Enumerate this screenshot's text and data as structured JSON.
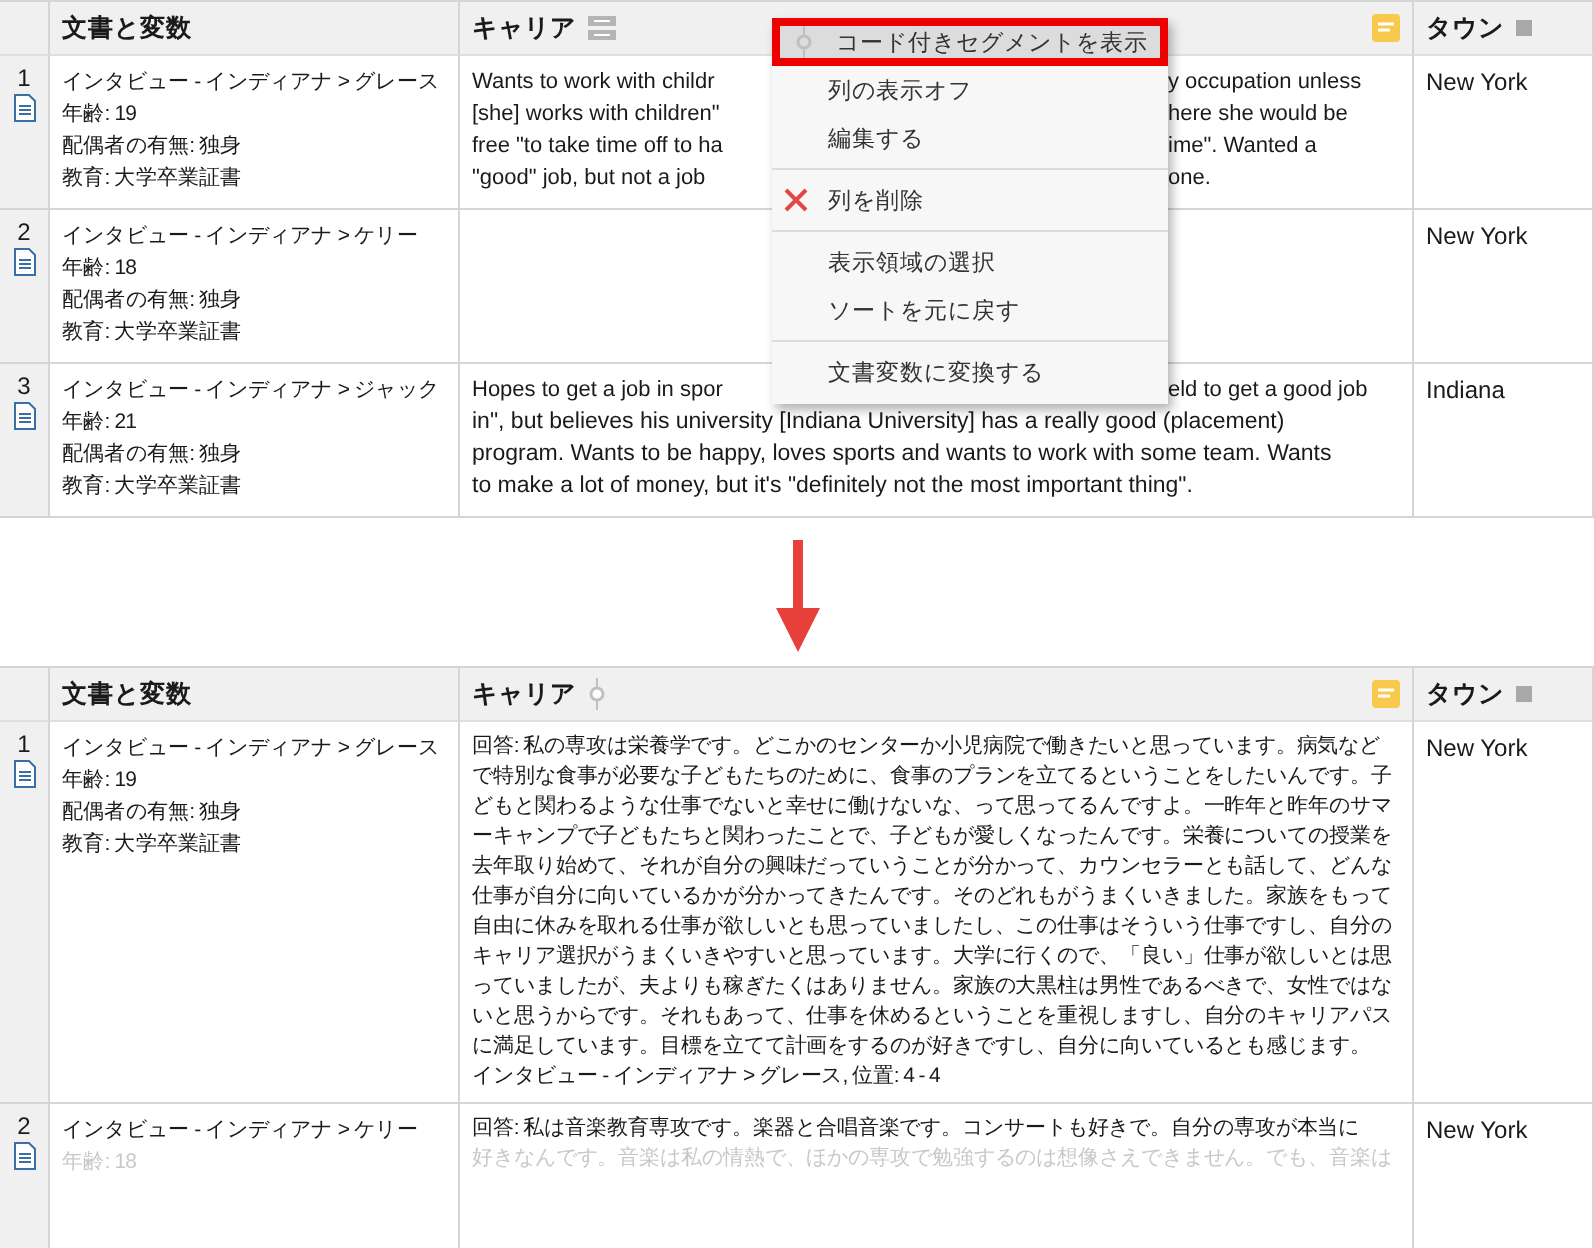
{
  "before": {
    "columns": [
      {
        "label": "文書と変数",
        "kind": "document",
        "memo": false
      },
      {
        "label": "キャリア",
        "kind": "layout",
        "memo": true
      },
      {
        "label": "タウン",
        "kind": "category",
        "memo": false
      }
    ],
    "rows": [
      {
        "number": "1",
        "doc": [
          {
            "text": "インタビュー - インディアナ > グレース",
            "faded": false
          },
          {
            "text": "年齢: 19",
            "faded": false
          },
          {
            "text": "配偶者の有無: 独身",
            "faded": false
          },
          {
            "text": "教育: 大学卒業証書",
            "faded": false
          }
        ],
        "career": [
          {
            "left": "Wants to work with childr",
            "right": "y occupation unless"
          },
          {
            "left": "[she] works with children\"",
            "right": "here she would be"
          },
          {
            "left": "free \"to take time off to ha",
            "right": "ime\". Wanted a"
          },
          {
            "left": "\"good\" job, but not a job",
            "right": "one."
          }
        ],
        "town": "New York"
      },
      {
        "number": "2",
        "doc": [
          {
            "text": "インタビュー - インディアナ > ケリー",
            "faded": false
          },
          {
            "text": "年齢: 18",
            "faded": false
          },
          {
            "text": "配偶者の有無: 独身",
            "faded": false
          },
          {
            "text": "教育: 大学卒業証書",
            "faded": false
          }
        ],
        "career": [],
        "town": "New York"
      },
      {
        "number": "3",
        "doc": [
          {
            "text": "インタビュー - インディアナ > ジャック",
            "faded": false
          },
          {
            "text": "年齢: 21",
            "faded": false
          },
          {
            "text": "配偶者の有無: 独身",
            "faded": false
          },
          {
            "text": "教育: 大学卒業証書",
            "faded": false
          }
        ],
        "career": [
          {
            "left": "Hopes to get a job in spor",
            "right": "eld to get a good job"
          },
          {
            "left": "in\", but believes his university [Indiana University] has a really good (placement)"
          },
          {
            "left": "program. Wants to be happy, loves sports and wants to work with some team. Wants"
          },
          {
            "left": "to make a lot of money, but it's \"definitely not the most important thing\"."
          }
        ],
        "town": "Indiana"
      }
    ],
    "menu": {
      "groups": [
        [
          {
            "label": "コード付きセグメントを表示",
            "kind": "pin",
            "selected": true
          },
          {
            "label": "列の表示オフ",
            "kind": "plain",
            "selected": false
          },
          {
            "label": "編集する",
            "kind": "plain",
            "selected": false
          }
        ],
        [
          {
            "label": "列を削除",
            "kind": "delete",
            "selected": false
          }
        ],
        [
          {
            "label": "表示領域の選択",
            "kind": "plain",
            "selected": false
          },
          {
            "label": "ソートを元に戻す",
            "kind": "plain",
            "selected": false
          }
        ],
        [
          {
            "label": "文書変数に変換する",
            "kind": "plain",
            "selected": false
          }
        ]
      ]
    }
  },
  "after": {
    "columns": [
      {
        "label": "文書と変数",
        "kind": "document",
        "memo": false
      },
      {
        "label": "キャリア",
        "kind": "pinned",
        "memo": true
      },
      {
        "label": "タウン",
        "kind": "category",
        "memo": false
      }
    ],
    "rows": [
      {
        "number": "1",
        "doc": [
          {
            "text": "インタビュー - インディアナ > グレース",
            "faded": false
          },
          {
            "text": "年齢: 19",
            "faded": false
          },
          {
            "text": "配偶者の有無: 独身",
            "faded": false
          },
          {
            "text": "教育: 大学卒業証書",
            "faded": false
          }
        ],
        "answer": [
          {
            "text": "回答: 私の専攻は栄養学です。どこかのセンターか小児病院で働きたいと思っています。病気などで特別な食事が必要な子どもたちのために、食事のプランを立てるということをしたいんです。子どもと関わるような仕事でないと幸せに働けないな、って思ってるんですよ。一昨年と昨年のサマーキャンプで子どもたちと関わったことで、子どもが愛しくなったんです。栄養についての授業を去年取り始めて、それが自分の興味だっていうことが分かって、カウンセラーとも話して、どんな仕事が自分に向いているかが分かってきたんです。そのどれもがうまくいきました。家族をもって自由に休みを取れる仕事が欲しいとも思っていましたし、この仕事はそういう仕事ですし、自分のキャリア選択がうまくいきやすいと思っています。大学に行くので、「良い」仕事が欲しいとは思っていましたが、夫よりも稼ぎたくはありません。家族の大黒柱は男性であるべきで、女性ではないと思うからです。それもあって、仕事を休めるということを重視しますし、自分のキャリアパスに満足しています。目標を立てて計画をするのが好きですし、自分に向いているとも感じます。",
            "faded": false
          }
        ],
        "source": "インタビュー - インディアナ > グレース, 位置: 4 - 4",
        "town": "New York"
      },
      {
        "number": "2",
        "doc": [
          {
            "text": "インタビュー - インディアナ > ケリー",
            "faded": false
          },
          {
            "text": "年齢: 18",
            "faded": true
          }
        ],
        "answer": [
          {
            "text": "回答: 私は音楽教育専攻です。楽器と合唱音楽です。コンサートも好きで。自分の専攻が本当に",
            "faded": false
          },
          {
            "text": "好きなんです。音楽は私の情熱で、ほかの専攻で勉強するのは想像さえできません。でも、音楽は",
            "faded": true
          }
        ],
        "town": "New York"
      }
    ]
  }
}
